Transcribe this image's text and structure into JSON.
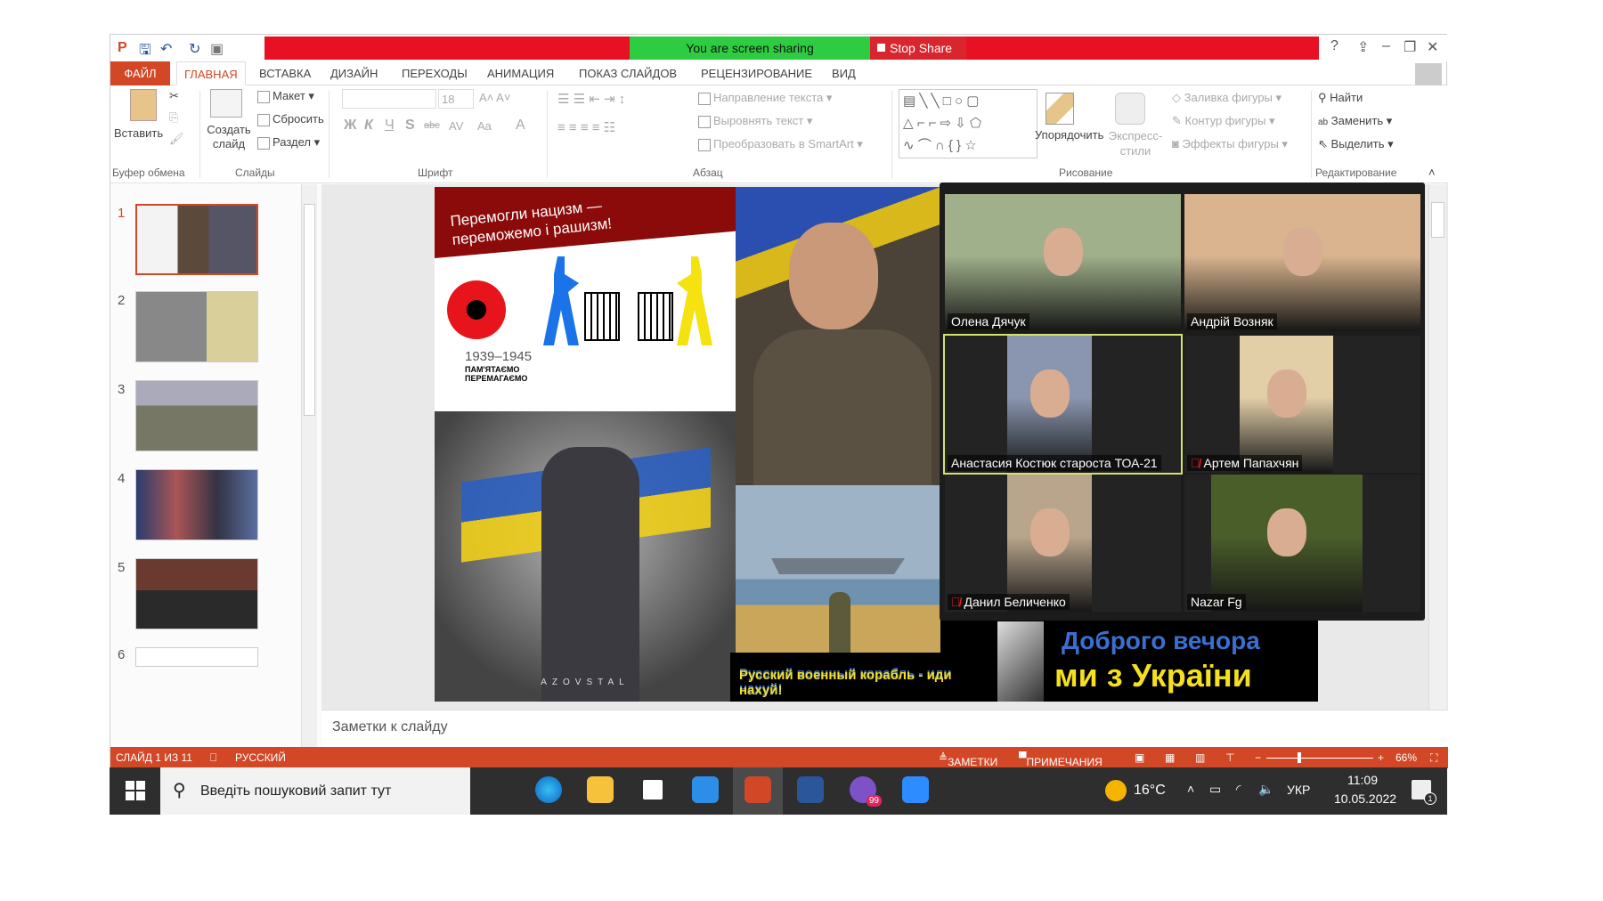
{
  "titlebar": {
    "share_status": "You are screen sharing",
    "stop_share": "Stop Share",
    "help": "?",
    "minimize": "–",
    "restore": "❐",
    "close": "✕"
  },
  "tabs": [
    "ФАЙЛ",
    "ГЛАВНАЯ",
    "ВСТАВКА",
    "ДИЗАЙН",
    "ПЕРЕХОДЫ",
    "АНИМАЦИЯ",
    "ПОКАЗ СЛАЙДОВ",
    "РЕЦЕНЗИРОВАНИЕ",
    "ВИД"
  ],
  "active_tab": "ГЛАВНАЯ",
  "ribbon": {
    "clipboard": {
      "paste": "Вставить",
      "label": "Буфер обмена"
    },
    "slides": {
      "new_slide": "Создать слайд",
      "layout": "Макет",
      "reset": "Сбросить",
      "section": "Раздел",
      "label": "Слайды"
    },
    "font": {
      "size": "18",
      "bold": "Ж",
      "italic": "К",
      "underline": "Ч",
      "shadow": "S",
      "strike": "abc",
      "spacing": "AV",
      "case": "Aa",
      "color": "A",
      "label": "Шрифт"
    },
    "paragraph": {
      "text_direction": "Направление текста",
      "align_text": "Выровнять текст",
      "smartart": "Преобразовать в SmartArt",
      "label": "Абзац"
    },
    "drawing": {
      "arrange": "Упорядочить",
      "quick_styles": "Экспресс-стили",
      "fill": "Заливка фигуры",
      "outline": "Контур фигуры",
      "effects": "Эффекты фигуры",
      "label": "Рисование"
    },
    "editing": {
      "find": "Найти",
      "replace": "Заменить",
      "select": "Выделить",
      "label": "Редактирование"
    }
  },
  "thumbnails": [
    "1",
    "2",
    "3",
    "4",
    "5",
    "6"
  ],
  "selected_slide": 1,
  "slide": {
    "banner": "Перемогли нацизм — переможемо і рашизм!",
    "years": "1939–1945",
    "remember": "ПАМ'ЯТАЄМО ПЕРЕМАГАЄМО",
    "azovstal": "AZOVSTAL",
    "ship_caption": "Русский военный корабль - иди нахуй!",
    "greeting_line1": "Доброго вечора",
    "greeting_line2": "ми з України"
  },
  "notes_placeholder": "Заметки к слайду",
  "status": {
    "slide_of": "СЛАЙД 1 ИЗ 11",
    "language": "РУССКИЙ",
    "notes": "ЗАМЕТКИ",
    "comments": "ПРИМЕЧАНИЯ",
    "zoom": "66%",
    "zoom_level": 66
  },
  "participants": [
    {
      "name": "Олена Дячук",
      "muted": false,
      "bg": "#9fb08a"
    },
    {
      "name": "Андрій Возняк",
      "muted": false,
      "bg": "#d9b48e"
    },
    {
      "name": "Анастасия Костюк староста ТОА-21",
      "muted": false,
      "active": true,
      "bg": "#8a96b0"
    },
    {
      "name": "Артем Папахчян",
      "muted": true,
      "bg": "#e2cfa8"
    },
    {
      "name": "Данил Беличенко",
      "muted": true,
      "bg": "#b9a58c"
    },
    {
      "name": "Nazar Fg",
      "muted": false,
      "bg": "#4a5e2a"
    }
  ],
  "taskbar": {
    "search_placeholder": "Введіть пошуковий запит тут",
    "viber_badge": "99",
    "weather": "16°C",
    "language": "УКР",
    "time": "11:09",
    "date": "10.05.2022",
    "notifications": "1"
  },
  "colors": {
    "accent": "#d24726",
    "share_green": "#2ecc40",
    "share_red": "#e81123",
    "slide_banner": "#8b0a0a",
    "greeting_blue": "#3a6fd1",
    "greeting_yellow": "#f4e01c"
  }
}
